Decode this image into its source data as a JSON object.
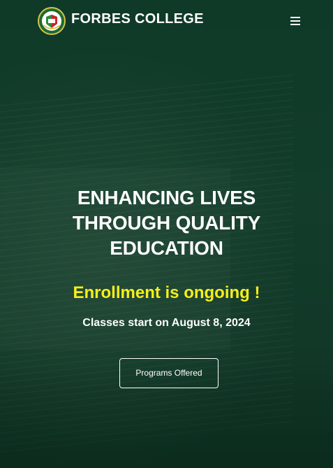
{
  "header": {
    "brand": "FORBES COLLEGE",
    "logo_icon": "forbes-college-seal",
    "menu_icon": "hamburger-menu-icon"
  },
  "hero": {
    "headline": "ENHANCING LIVES THROUGH QUALITY EDUCATION",
    "enrollment": "Enrollment is ongoing !",
    "classes_start": "Classes start on August 8, 2024",
    "cta_label": "Programs Offered"
  },
  "colors": {
    "background": "#0f3a28",
    "accent_yellow": "#f5ef1a",
    "text": "#ffffff"
  }
}
